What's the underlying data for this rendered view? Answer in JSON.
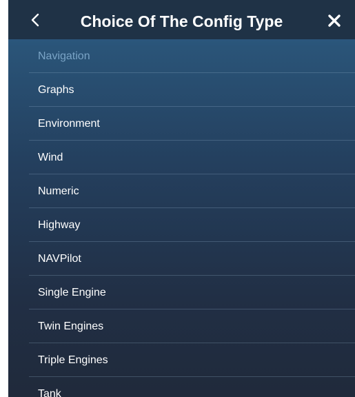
{
  "header": {
    "title": "Choice Of The Config Type",
    "back_icon": "chevron-left-icon",
    "close_icon": "close-icon"
  },
  "colors": {
    "header_bg": "#1f3246",
    "list_bg_top": "#2f6390",
    "list_bg_bottom": "#202a3b",
    "text": "#ffffff",
    "disabled_text": "#7aa4c6"
  },
  "items": [
    {
      "label": "Navigation",
      "enabled": false
    },
    {
      "label": "Graphs",
      "enabled": true
    },
    {
      "label": "Environment",
      "enabled": true
    },
    {
      "label": "Wind",
      "enabled": true
    },
    {
      "label": "Numeric",
      "enabled": true
    },
    {
      "label": "Highway",
      "enabled": true
    },
    {
      "label": "NAVPilot",
      "enabled": true
    },
    {
      "label": "Single Engine",
      "enabled": true
    },
    {
      "label": "Twin Engines",
      "enabled": true
    },
    {
      "label": "Triple Engines",
      "enabled": true
    },
    {
      "label": "Tank",
      "enabled": true
    }
  ]
}
